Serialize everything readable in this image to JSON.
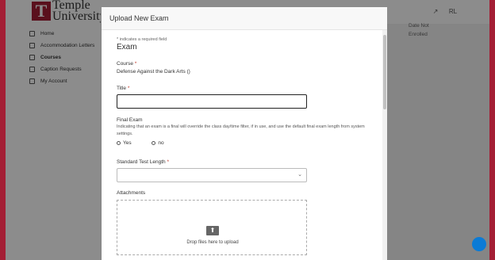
{
  "sidebar": {
    "logo_letter": "T",
    "logo_text_line1": "Temple",
    "logo_text_line2": "University",
    "items": [
      {
        "label": "Home"
      },
      {
        "label": "Accommodation Letters"
      },
      {
        "label": "Courses"
      },
      {
        "label": "Caption Requests"
      },
      {
        "label": "My Account"
      }
    ]
  },
  "topbar": {
    "user_initials": "RL"
  },
  "background_page": {
    "text1": "Date Not",
    "text2": "Enrolled"
  },
  "modal": {
    "title": "Upload New Exam",
    "required_note": "* indicates a required field",
    "section_title": "Exam",
    "course_label": "Course",
    "course_value": "Defense Against the Dark Arts ()",
    "title_label": "Title",
    "title_value": "",
    "final_exam_label": "Final Exam",
    "final_exam_help": "Indicating that an exam is a final will override the class day/time filter, if in use, and use the default final exam length from system settings.",
    "final_yes": "Yes",
    "final_no": "no",
    "test_length_label": "Standard Test Length",
    "test_length_value": "",
    "attachments_label": "Attachments",
    "drop_text": "Drop files here to upload"
  },
  "colors": {
    "brand": "#a41e35",
    "fab": "#0b7bd6"
  }
}
